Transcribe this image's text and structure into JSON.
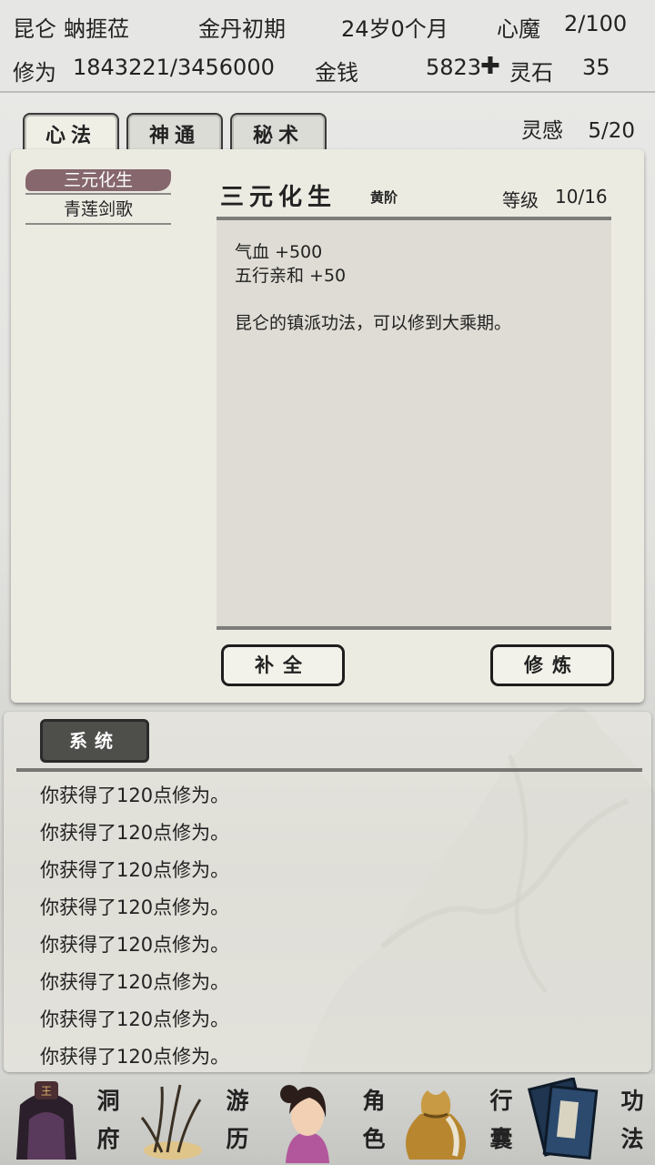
{
  "status": {
    "sect": "昆仑",
    "name": "蚋捱莅",
    "realm": "金丹初期",
    "age": "24岁0个月",
    "heart_demon_label": "心魔",
    "heart_demon_value": "2/100",
    "cultivation_label": "修为",
    "cultivation_value": "1843221/3456000",
    "money_label": "金钱",
    "money_value": "5823",
    "spirit_stone_label": "灵石",
    "spirit_stone_value": "35"
  },
  "tabs": [
    {
      "label": "心法",
      "active": true
    },
    {
      "label": "神通",
      "active": false
    },
    {
      "label": "秘术",
      "active": false
    }
  ],
  "inspiration": {
    "label": "灵感",
    "value": "5/20"
  },
  "skill_list": [
    {
      "name": "三元化生",
      "selected": true
    },
    {
      "name": "青莲剑歌",
      "selected": false
    }
  ],
  "detail": {
    "title": "三元化生",
    "grade": "黄阶",
    "level_label": "等级",
    "level_value": "10/16",
    "effects": [
      "气血 +500",
      "五行亲和 +50"
    ],
    "description": "昆仑的镇派功法，可以修到大乘期。"
  },
  "buttons": {
    "fill": "补全",
    "practice": "修炼"
  },
  "log": {
    "tab_label": "系统",
    "lines": [
      "你获得了120点修为。",
      "你获得了120点修为。",
      "你获得了120点修为。",
      "你获得了120点修为。",
      "你获得了120点修为。",
      "你获得了120点修为。",
      "你获得了120点修为。",
      "你获得了120点修为。"
    ]
  },
  "nav": [
    {
      "label1": "洞",
      "label2": "府",
      "icon": "cave-dwelling-icon"
    },
    {
      "label1": "游",
      "label2": "历",
      "icon": "journey-icon"
    },
    {
      "label1": "角",
      "label2": "色",
      "icon": "character-icon"
    },
    {
      "label1": "行",
      "label2": "囊",
      "icon": "bag-icon"
    },
    {
      "label1": "功",
      "label2": "法",
      "icon": "scroll-book-icon"
    }
  ]
}
